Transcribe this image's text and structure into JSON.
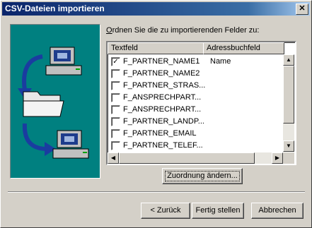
{
  "window": {
    "title": "CSV-Dateien importieren"
  },
  "instruction": {
    "prefix": "O",
    "rest": "rdnen Sie die zu importierenden Felder zu:"
  },
  "table": {
    "columns": [
      "Textfeld",
      "Adressbuchfeld"
    ],
    "rows": [
      {
        "field": "F_PARTNER_NAME1",
        "mapped": "Name",
        "checked": true
      },
      {
        "field": "F_PARTNER_NAME2",
        "mapped": "",
        "checked": false
      },
      {
        "field": "F_PARTNER_STRAS...",
        "mapped": "",
        "checked": false
      },
      {
        "field": "F_ANSPRECHPART...",
        "mapped": "",
        "checked": false
      },
      {
        "field": "F_ANSPRECHPART...",
        "mapped": "",
        "checked": false
      },
      {
        "field": "F_PARTNER_LANDP...",
        "mapped": "",
        "checked": false
      },
      {
        "field": "F_PARTNER_EMAIL",
        "mapped": "",
        "checked": false
      },
      {
        "field": "F_PARTNER_TELEF...",
        "mapped": "",
        "checked": false
      }
    ]
  },
  "buttons": {
    "change_mapping": "Zuordnung ändern...",
    "back": "< Zurück",
    "finish": "Fertig stellen",
    "cancel": "Abbrechen"
  },
  "icons": {
    "close": "close-icon",
    "checkmark": "checkmark-icon"
  }
}
